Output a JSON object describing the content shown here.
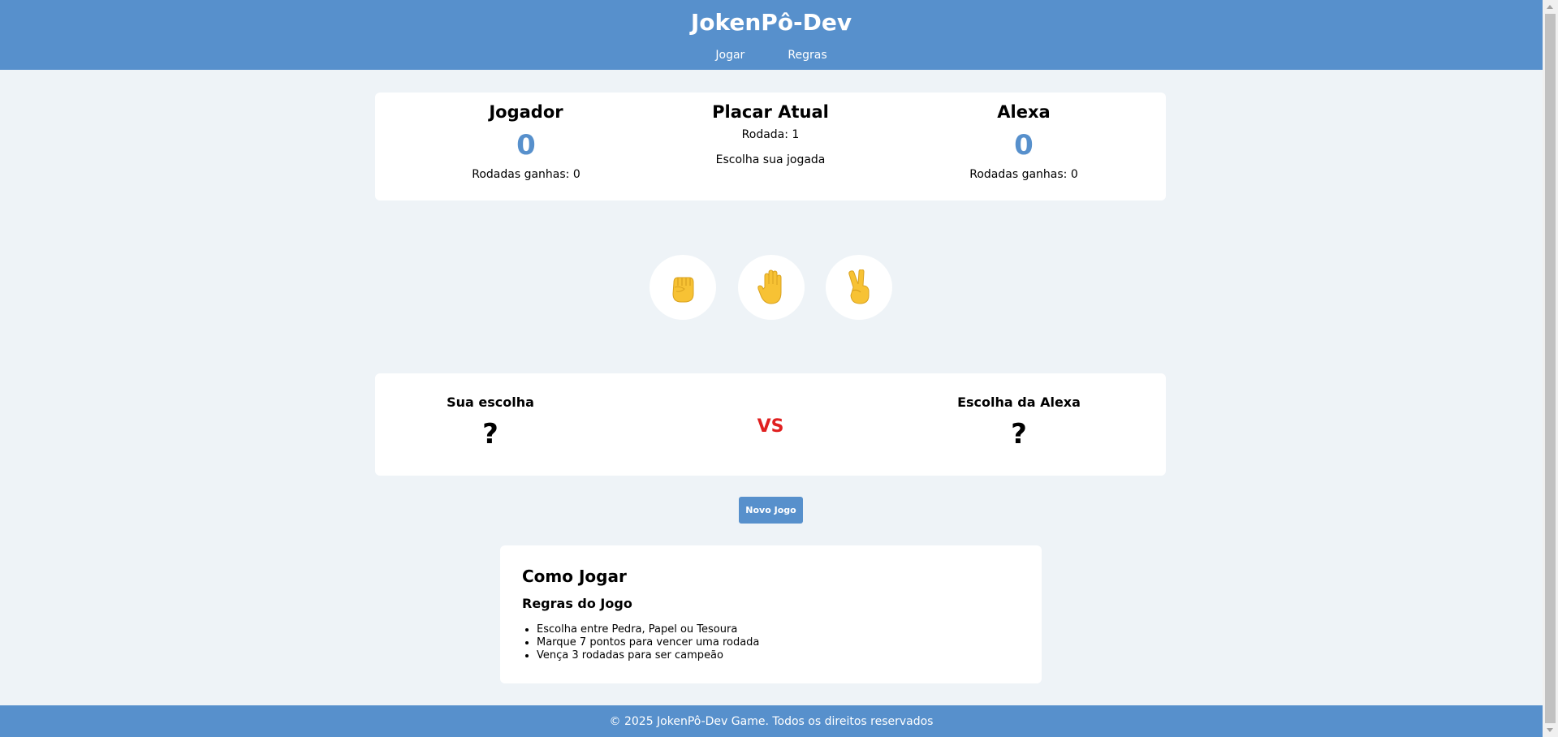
{
  "header": {
    "title": "JokenPô-Dev",
    "nav": [
      {
        "label": "Jogar"
      },
      {
        "label": "Regras"
      }
    ]
  },
  "scoreboard": {
    "player": {
      "name": "Jogador",
      "score": "0",
      "rounds_label": "Rodadas ganhas: 0"
    },
    "center": {
      "title": "Placar Atual",
      "round_label": "Rodada: 1",
      "status": "Escolha sua jogada"
    },
    "opponent": {
      "name": "Alexa",
      "score": "0",
      "rounds_label": "Rodadas ganhas: 0"
    }
  },
  "choices": [
    {
      "name": "pedra",
      "icon": "fist-icon"
    },
    {
      "name": "papel",
      "icon": "open-hand-icon"
    },
    {
      "name": "tesoura",
      "icon": "victory-hand-icon"
    }
  ],
  "versus": {
    "player_label": "Sua escolha",
    "player_choice": "?",
    "vs": "VS",
    "opponent_label": "Escolha da Alexa",
    "opponent_choice": "?"
  },
  "new_game_label": "Novo Jogo",
  "rules": {
    "title": "Como Jogar",
    "subtitle": "Regras do Jogo",
    "items": [
      "Escolha entre Pedra, Papel ou Tesoura",
      "Marque 7 pontos para vencer uma rodada",
      "Vença 3 rodadas para ser campeão"
    ]
  },
  "footer": {
    "text": "© 2025 JokenPô-Dev Game. Todos os direitos reservados"
  },
  "colors": {
    "primary": "#5790cc",
    "background": "#eef3f7",
    "vs": "#e02020",
    "hand": "#f7c234"
  }
}
